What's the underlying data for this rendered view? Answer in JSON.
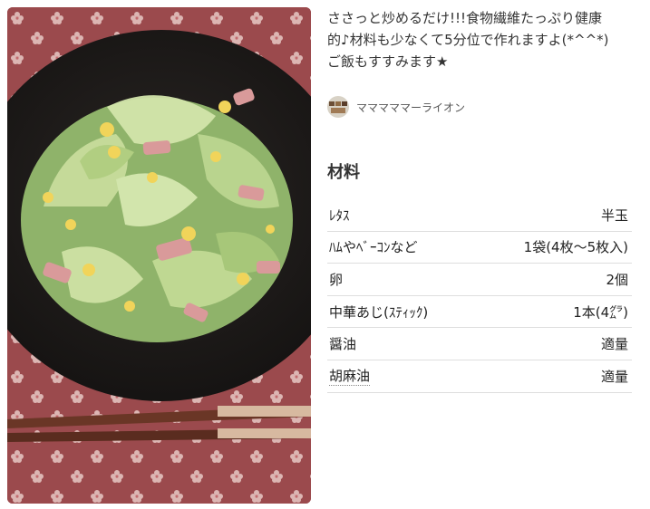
{
  "recipe": {
    "description": "ささっと炒めるだけ!!!食物繊維たっぷり健康\n的♪材料も少なくて5分位で作れますよ(*^^*)\nご飯もすすみます★",
    "author": {
      "name": "マママママーライオン"
    },
    "ingredients_title": "材料",
    "ingredients": [
      {
        "name": "ﾚﾀｽ",
        "amount": "半玉"
      },
      {
        "name": "ﾊﾑやﾍﾞｰｺﾝなど",
        "amount": "1袋(4枚～5枚入)"
      },
      {
        "name": "卵",
        "amount": "2個"
      },
      {
        "name": "中華あじ(ｽﾃｨｯｸ)",
        "amount": "1本(4㌘)"
      },
      {
        "name": "醤油",
        "amount": "適量"
      },
      {
        "name": "胡麻油",
        "amount": "適量"
      }
    ]
  },
  "colors": {
    "tablecloth": "#9b4a4d",
    "plate": "#1e1b1a",
    "lettuce": "#b9d48a",
    "ham": "#d99a9a",
    "egg": "#f1d45a"
  }
}
